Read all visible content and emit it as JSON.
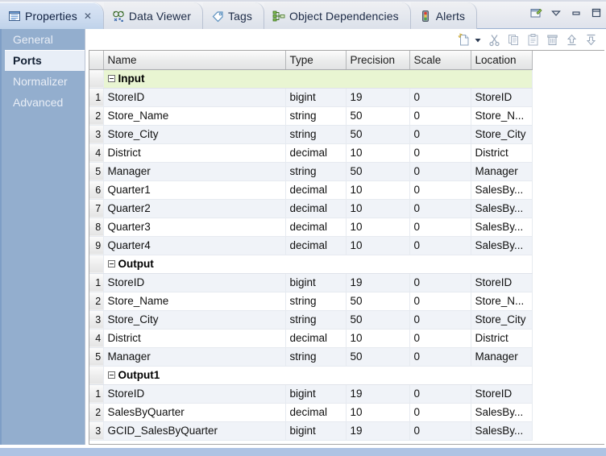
{
  "window": {
    "tabs": [
      {
        "label": "Properties",
        "icon": "properties-icon",
        "active": true,
        "closable": true
      },
      {
        "label": "Data Viewer",
        "icon": "data-viewer-icon",
        "active": false,
        "closable": false
      },
      {
        "label": "Tags",
        "icon": "tag-icon",
        "active": false,
        "closable": false
      },
      {
        "label": "Object Dependencies",
        "icon": "object-dependencies-icon",
        "active": false,
        "closable": false
      },
      {
        "label": "Alerts",
        "icon": "alerts-traffic-light-icon",
        "active": false,
        "closable": false
      }
    ],
    "close_glyph": "✕",
    "view_tools": [
      {
        "name": "view-menu-pin-icon"
      },
      {
        "name": "view-menu-chevron-down-icon"
      },
      {
        "name": "minimize-icon"
      },
      {
        "name": "maximize-icon"
      }
    ]
  },
  "sidebar": {
    "items": [
      {
        "label": "General",
        "selected": false
      },
      {
        "label": "Ports",
        "selected": true
      },
      {
        "label": "Normalizer",
        "selected": false
      },
      {
        "label": "Advanced",
        "selected": false
      }
    ]
  },
  "toolbar": {
    "buttons": [
      {
        "name": "new-port-icon",
        "label": "New"
      },
      {
        "name": "new-port-dropdown-arrow-icon",
        "label": "New options"
      },
      {
        "name": "cut-icon",
        "label": "Cut"
      },
      {
        "name": "copy-icon",
        "label": "Copy"
      },
      {
        "name": "paste-icon",
        "label": "Paste"
      },
      {
        "name": "delete-trash-icon",
        "label": "Delete"
      },
      {
        "name": "move-up-icon",
        "label": "Move Up"
      },
      {
        "name": "move-down-icon",
        "label": "Move Down"
      }
    ]
  },
  "table": {
    "columns": [
      "Name",
      "Type",
      "Precision",
      "Scale",
      "Location"
    ],
    "groups": [
      {
        "name": "Input",
        "highlight": "#e9f5d2",
        "expanded": true,
        "rows": [
          {
            "n": "1",
            "name": "StoreID",
            "type": "bigint",
            "precision": "19",
            "scale": "0",
            "location": "StoreID",
            "name_dim": false,
            "scale_bold": false
          },
          {
            "n": "2",
            "name": "Store_Name",
            "type": "string",
            "precision": "50",
            "scale": "0",
            "location": "Store_N...",
            "name_dim": false,
            "scale_bold": false
          },
          {
            "n": "3",
            "name": "Store_City",
            "type": "string",
            "precision": "50",
            "scale": "0",
            "location": "Store_City",
            "name_dim": false,
            "scale_bold": false
          },
          {
            "n": "4",
            "name": "District",
            "type": "decimal",
            "precision": "10",
            "scale": "0",
            "location": "District",
            "name_dim": false,
            "scale_bold": true
          },
          {
            "n": "5",
            "name": "Manager",
            "type": "string",
            "precision": "50",
            "scale": "0",
            "location": "Manager",
            "name_dim": false,
            "scale_bold": false
          },
          {
            "n": "6",
            "name": "Quarter1",
            "type": "decimal",
            "precision": "10",
            "scale": "0",
            "location": "SalesBy...",
            "name_dim": false,
            "scale_bold": true
          },
          {
            "n": "7",
            "name": "Quarter2",
            "type": "decimal",
            "precision": "10",
            "scale": "0",
            "location": "SalesBy...",
            "name_dim": false,
            "scale_bold": true
          },
          {
            "n": "8",
            "name": "Quarter3",
            "type": "decimal",
            "precision": "10",
            "scale": "0",
            "location": "SalesBy...",
            "name_dim": false,
            "scale_bold": true
          },
          {
            "n": "9",
            "name": "Quarter4",
            "type": "decimal",
            "precision": "10",
            "scale": "0",
            "location": "SalesBy...",
            "name_dim": false,
            "scale_bold": true
          }
        ]
      },
      {
        "name": "Output",
        "highlight": "#ffffff",
        "expanded": true,
        "rows": [
          {
            "n": "1",
            "name": "StoreID",
            "type": "bigint",
            "precision": "19",
            "scale": "0",
            "location": "StoreID",
            "name_dim": true,
            "scale_bold": false
          },
          {
            "n": "2",
            "name": "Store_Name",
            "type": "string",
            "precision": "50",
            "scale": "0",
            "location": "Store_N...",
            "name_dim": true,
            "scale_bold": false
          },
          {
            "n": "3",
            "name": "Store_City",
            "type": "string",
            "precision": "50",
            "scale": "0",
            "location": "Store_City",
            "name_dim": true,
            "scale_bold": false
          },
          {
            "n": "4",
            "name": "District",
            "type": "decimal",
            "precision": "10",
            "scale": "0",
            "location": "District",
            "name_dim": true,
            "scale_bold": true
          },
          {
            "n": "5",
            "name": "Manager",
            "type": "string",
            "precision": "50",
            "scale": "0",
            "location": "Manager",
            "name_dim": true,
            "scale_bold": false
          }
        ]
      },
      {
        "name": "Output1",
        "highlight": "#ffffff",
        "expanded": true,
        "rows": [
          {
            "n": "1",
            "name": "StoreID",
            "type": "bigint",
            "precision": "19",
            "scale": "0",
            "location": "StoreID",
            "name_dim": true,
            "scale_bold": false
          },
          {
            "n": "2",
            "name": "SalesByQuarter",
            "type": "decimal",
            "precision": "10",
            "scale": "0",
            "location": "SalesBy...",
            "name_dim": true,
            "scale_bold": true
          },
          {
            "n": "3",
            "name": "GCID_SalesByQuarter",
            "type": "bigint",
            "precision": "19",
            "scale": "0",
            "location": "SalesBy...",
            "name_dim": true,
            "scale_bold": false
          }
        ]
      }
    ]
  }
}
